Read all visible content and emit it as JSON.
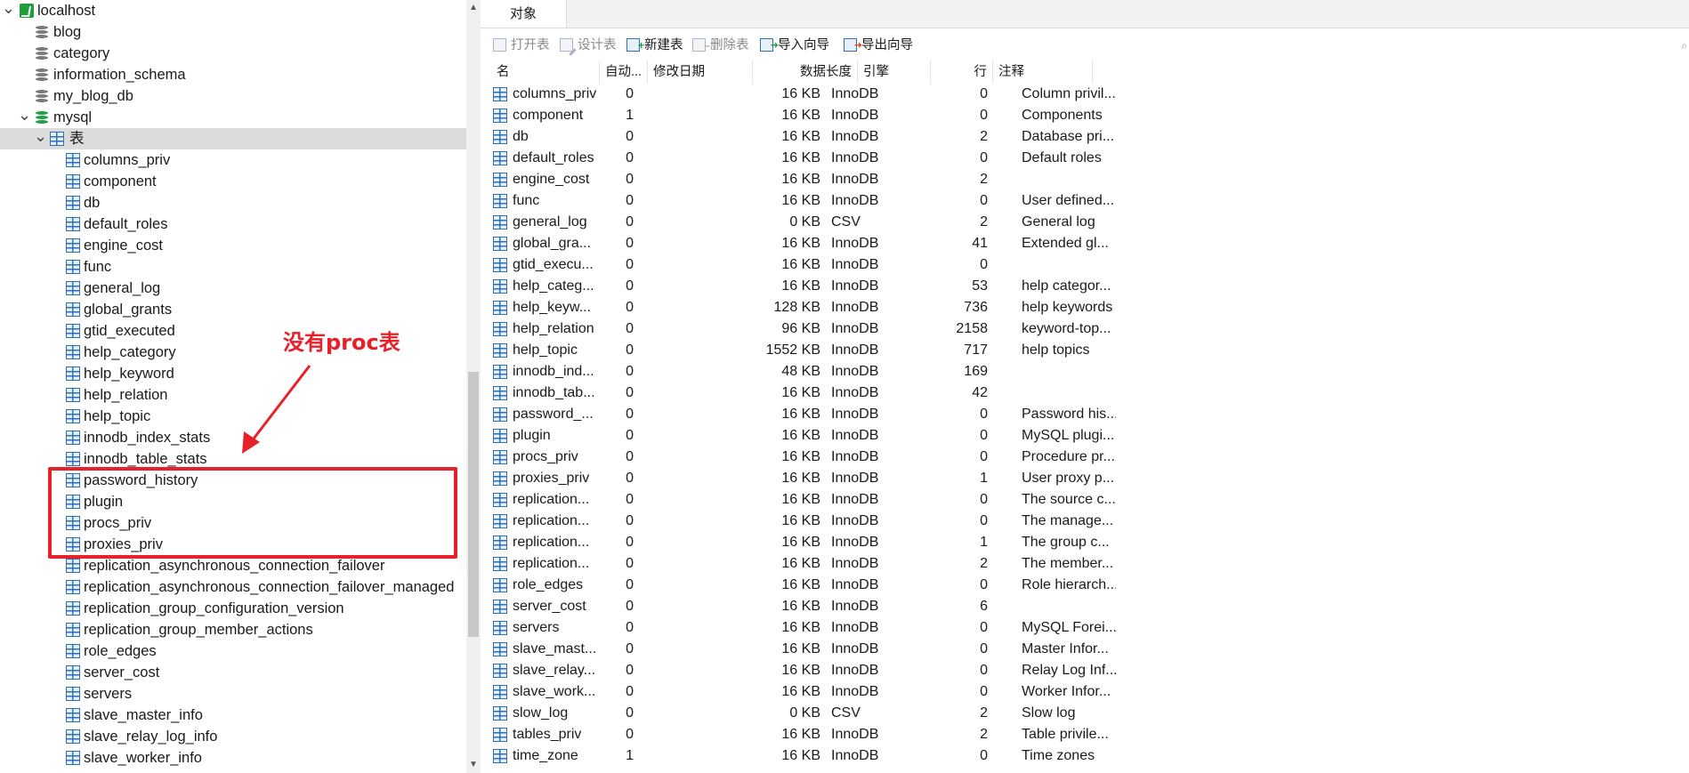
{
  "tree": {
    "nodes": [
      {
        "label": "localhost",
        "level": 0,
        "icon": "server-icon",
        "expand": "open"
      },
      {
        "label": "blog",
        "level": 1,
        "icon": "database-icon"
      },
      {
        "label": "category",
        "level": 1,
        "icon": "database-icon"
      },
      {
        "label": "information_schema",
        "level": 1,
        "icon": "database-icon"
      },
      {
        "label": "my_blog_db",
        "level": 1,
        "icon": "database-icon"
      },
      {
        "label": "mysql",
        "level": 1,
        "icon": "database-open-icon",
        "expand": "open"
      },
      {
        "label": "表",
        "level": 2,
        "icon": "tables-folder-icon",
        "expand": "open",
        "selected": true
      },
      {
        "label": "columns_priv",
        "level": 3,
        "icon": "table-icon"
      },
      {
        "label": "component",
        "level": 3,
        "icon": "table-icon"
      },
      {
        "label": "db",
        "level": 3,
        "icon": "table-icon"
      },
      {
        "label": "default_roles",
        "level": 3,
        "icon": "table-icon"
      },
      {
        "label": "engine_cost",
        "level": 3,
        "icon": "table-icon"
      },
      {
        "label": "func",
        "level": 3,
        "icon": "table-icon"
      },
      {
        "label": "general_log",
        "level": 3,
        "icon": "table-icon"
      },
      {
        "label": "global_grants",
        "level": 3,
        "icon": "table-icon"
      },
      {
        "label": "gtid_executed",
        "level": 3,
        "icon": "table-icon"
      },
      {
        "label": "help_category",
        "level": 3,
        "icon": "table-icon"
      },
      {
        "label": "help_keyword",
        "level": 3,
        "icon": "table-icon"
      },
      {
        "label": "help_relation",
        "level": 3,
        "icon": "table-icon"
      },
      {
        "label": "help_topic",
        "level": 3,
        "icon": "table-icon"
      },
      {
        "label": "innodb_index_stats",
        "level": 3,
        "icon": "table-icon"
      },
      {
        "label": "innodb_table_stats",
        "level": 3,
        "icon": "table-icon"
      },
      {
        "label": "password_history",
        "level": 3,
        "icon": "table-icon"
      },
      {
        "label": "plugin",
        "level": 3,
        "icon": "table-icon"
      },
      {
        "label": "procs_priv",
        "level": 3,
        "icon": "table-icon"
      },
      {
        "label": "proxies_priv",
        "level": 3,
        "icon": "table-icon"
      },
      {
        "label": "replication_asynchronous_connection_failover",
        "level": 3,
        "icon": "table-icon"
      },
      {
        "label": "replication_asynchronous_connection_failover_managed",
        "level": 3,
        "icon": "table-icon"
      },
      {
        "label": "replication_group_configuration_version",
        "level": 3,
        "icon": "table-icon"
      },
      {
        "label": "replication_group_member_actions",
        "level": 3,
        "icon": "table-icon"
      },
      {
        "label": "role_edges",
        "level": 3,
        "icon": "table-icon"
      },
      {
        "label": "server_cost",
        "level": 3,
        "icon": "table-icon"
      },
      {
        "label": "servers",
        "level": 3,
        "icon": "table-icon"
      },
      {
        "label": "slave_master_info",
        "level": 3,
        "icon": "table-icon"
      },
      {
        "label": "slave_relay_log_info",
        "level": 3,
        "icon": "table-icon"
      },
      {
        "label": "slave_worker_info",
        "level": 3,
        "icon": "table-icon"
      }
    ]
  },
  "annotation": {
    "text": "没有proc表",
    "color": "#e8202a"
  },
  "tabs": [
    {
      "label": "对象"
    }
  ],
  "toolbar": {
    "buttons": [
      {
        "label": "打开表",
        "enabled": false,
        "icon": "open-table-icon"
      },
      {
        "label": "设计表",
        "enabled": false,
        "icon": "design-table-icon"
      },
      {
        "label": "新建表",
        "enabled": true,
        "icon": "new-table-icon"
      },
      {
        "label": "删除表",
        "enabled": false,
        "icon": "delete-table-icon"
      },
      {
        "label": "导入向导",
        "enabled": true,
        "icon": "import-wizard-icon"
      },
      {
        "label": "导出向导",
        "enabled": true,
        "icon": "export-wizard-icon"
      }
    ]
  },
  "table": {
    "columns": [
      "名",
      "自动...",
      "修改日期",
      "数据长度",
      "引擎",
      "行",
      "注释"
    ],
    "rows": [
      [
        "columns_priv",
        "0",
        "",
        "16 KB",
        "InnoDB",
        "0",
        "Column privil..."
      ],
      [
        "component",
        "1",
        "",
        "16 KB",
        "InnoDB",
        "0",
        "Components"
      ],
      [
        "db",
        "0",
        "",
        "16 KB",
        "InnoDB",
        "2",
        "Database pri..."
      ],
      [
        "default_roles",
        "0",
        "",
        "16 KB",
        "InnoDB",
        "0",
        "Default roles"
      ],
      [
        "engine_cost",
        "0",
        "",
        "16 KB",
        "InnoDB",
        "2",
        ""
      ],
      [
        "func",
        "0",
        "",
        "16 KB",
        "InnoDB",
        "0",
        "User defined..."
      ],
      [
        "general_log",
        "0",
        "",
        "0 KB",
        "CSV",
        "2",
        "General log"
      ],
      [
        "global_gra...",
        "0",
        "",
        "16 KB",
        "InnoDB",
        "41",
        "Extended gl..."
      ],
      [
        "gtid_execu...",
        "0",
        "",
        "16 KB",
        "InnoDB",
        "0",
        ""
      ],
      [
        "help_categ...",
        "0",
        "",
        "16 KB",
        "InnoDB",
        "53",
        "help categor..."
      ],
      [
        "help_keyw...",
        "0",
        "",
        "128 KB",
        "InnoDB",
        "736",
        "help keywords"
      ],
      [
        "help_relation",
        "0",
        "",
        "96 KB",
        "InnoDB",
        "2158",
        "keyword-top..."
      ],
      [
        "help_topic",
        "0",
        "",
        "1552 KB",
        "InnoDB",
        "717",
        "help topics"
      ],
      [
        "innodb_ind...",
        "0",
        "",
        "48 KB",
        "InnoDB",
        "169",
        ""
      ],
      [
        "innodb_tab...",
        "0",
        "",
        "16 KB",
        "InnoDB",
        "42",
        ""
      ],
      [
        "password_...",
        "0",
        "",
        "16 KB",
        "InnoDB",
        "0",
        "Password his..."
      ],
      [
        "plugin",
        "0",
        "",
        "16 KB",
        "InnoDB",
        "0",
        "MySQL plugi..."
      ],
      [
        "procs_priv",
        "0",
        "",
        "16 KB",
        "InnoDB",
        "0",
        "Procedure pr..."
      ],
      [
        "proxies_priv",
        "0",
        "",
        "16 KB",
        "InnoDB",
        "1",
        "User proxy p..."
      ],
      [
        "replication...",
        "0",
        "",
        "16 KB",
        "InnoDB",
        "0",
        "The source c..."
      ],
      [
        "replication...",
        "0",
        "",
        "16 KB",
        "InnoDB",
        "0",
        "The manage..."
      ],
      [
        "replication...",
        "0",
        "",
        "16 KB",
        "InnoDB",
        "1",
        "The group c..."
      ],
      [
        "replication...",
        "0",
        "",
        "16 KB",
        "InnoDB",
        "2",
        "The member..."
      ],
      [
        "role_edges",
        "0",
        "",
        "16 KB",
        "InnoDB",
        "0",
        "Role hierarch..."
      ],
      [
        "server_cost",
        "0",
        "",
        "16 KB",
        "InnoDB",
        "6",
        ""
      ],
      [
        "servers",
        "0",
        "",
        "16 KB",
        "InnoDB",
        "0",
        "MySQL Forei..."
      ],
      [
        "slave_mast...",
        "0",
        "",
        "16 KB",
        "InnoDB",
        "0",
        "Master Infor..."
      ],
      [
        "slave_relay...",
        "0",
        "",
        "16 KB",
        "InnoDB",
        "0",
        "Relay Log Inf..."
      ],
      [
        "slave_work...",
        "0",
        "",
        "16 KB",
        "InnoDB",
        "0",
        "Worker Infor..."
      ],
      [
        "slow_log",
        "0",
        "",
        "0 KB",
        "CSV",
        "2",
        "Slow log"
      ],
      [
        "tables_priv",
        "0",
        "",
        "16 KB",
        "InnoDB",
        "2",
        "Table privile..."
      ],
      [
        "time_zone",
        "1",
        "",
        "16 KB",
        "InnoDB",
        "0",
        "Time zones"
      ]
    ]
  }
}
